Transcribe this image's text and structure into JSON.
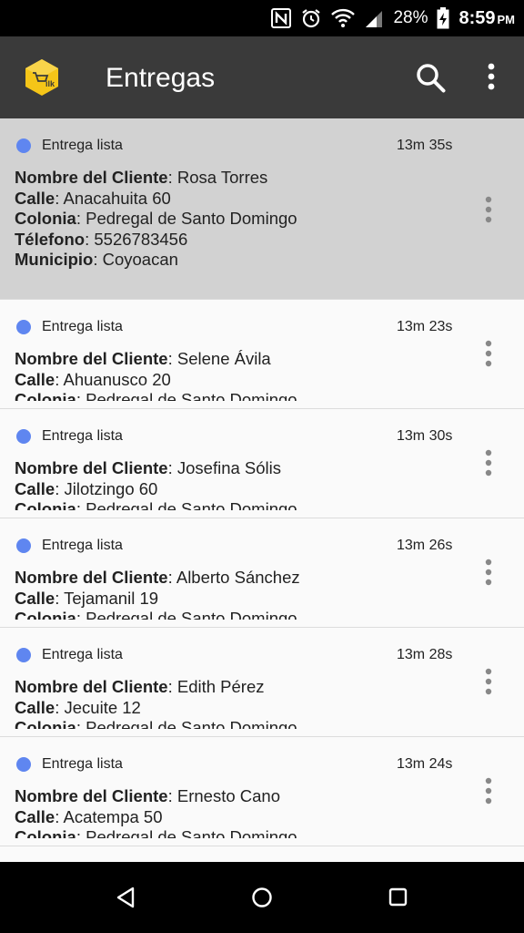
{
  "status_bar": {
    "battery_percent": "28%",
    "time": "8:59",
    "ampm": "PM",
    "icons": [
      "nfc-icon",
      "alarm-icon",
      "wifi-icon",
      "signal-icon",
      "battery-charging-icon"
    ]
  },
  "app_bar": {
    "title": "Entregas",
    "logo_icon": "app-logo-icon",
    "logo_color": "#f5c518",
    "search_icon": "search-icon",
    "menu_icon": "overflow-menu-icon",
    "background": "#3a3a3a"
  },
  "labels": {
    "client_name": "Nombre del Cliente",
    "street": "Calle",
    "neighborhood": "Colonia",
    "phone": "Télefono",
    "municipality": "Municipio"
  },
  "status_dot_color": "#5f86f0",
  "deliveries": [
    {
      "status": "Entrega lista",
      "elapsed": "13m 35s",
      "client": "Rosa Torres",
      "street": "Anacahuita 60",
      "neighborhood": "Pedregal de Santo Domingo",
      "phone": "5526783456",
      "municipality": "Coyoacan"
    },
    {
      "status": "Entrega lista",
      "elapsed": "13m 23s",
      "client": "Selene Ávila",
      "street": "Ahuanusco 20",
      "neighborhood": "Pedregal de Santo Domingo"
    },
    {
      "status": "Entrega lista",
      "elapsed": "13m 30s",
      "client": "Josefina Sólis",
      "street": "Jilotzingo 60",
      "neighborhood": "Pedregal de Santo Domingo"
    },
    {
      "status": "Entrega lista",
      "elapsed": "13m 26s",
      "client": "Alberto Sánchez",
      "street": "Tejamanil 19",
      "neighborhood": "Pedregal de Santo Domingo"
    },
    {
      "status": "Entrega lista",
      "elapsed": "13m 28s",
      "client": "Edith Pérez",
      "street": "Jecuite 12",
      "neighborhood": "Pedregal de Santo Domingo"
    },
    {
      "status": "Entrega lista",
      "elapsed": "13m 24s",
      "client": "Ernesto Cano",
      "street": "Acatempa 50",
      "neighborhood": "Pedregal de Santo Domingo"
    }
  ],
  "nav_bar": {
    "back_icon": "back-icon",
    "home_icon": "home-icon",
    "recents_icon": "recents-icon"
  }
}
